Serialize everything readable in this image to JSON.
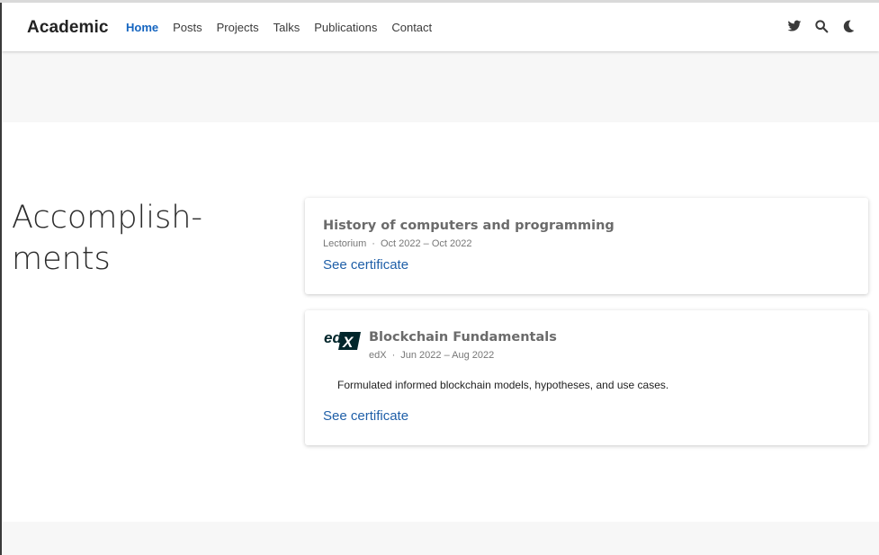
{
  "navbar": {
    "brand": "Academic",
    "links": [
      "Home",
      "Posts",
      "Projects",
      "Talks",
      "Publications",
      "Contact"
    ],
    "active": "Home",
    "icons": [
      "twitter-icon",
      "search-icon",
      "moon-icon"
    ]
  },
  "section": {
    "title_line1": "Accomplish-",
    "title_line2": "ments"
  },
  "accomplishments": [
    {
      "title": "History of computers and programming",
      "organization": "Lectorium",
      "dates": "Oct 2022 – Oct 2022",
      "link_label": "See certificate"
    },
    {
      "logo": "edX",
      "title": "Blockchain Fundamentals",
      "organization": "edX",
      "dates": "Jun 2022 – Aug 2022",
      "description": "Formulated informed blockchain models, hypotheses, and use cases.",
      "link_label": "See certificate"
    }
  ],
  "colors": {
    "accent": "#1565c0",
    "link": "#1f5fa8",
    "band": "#f7f7f7"
  }
}
